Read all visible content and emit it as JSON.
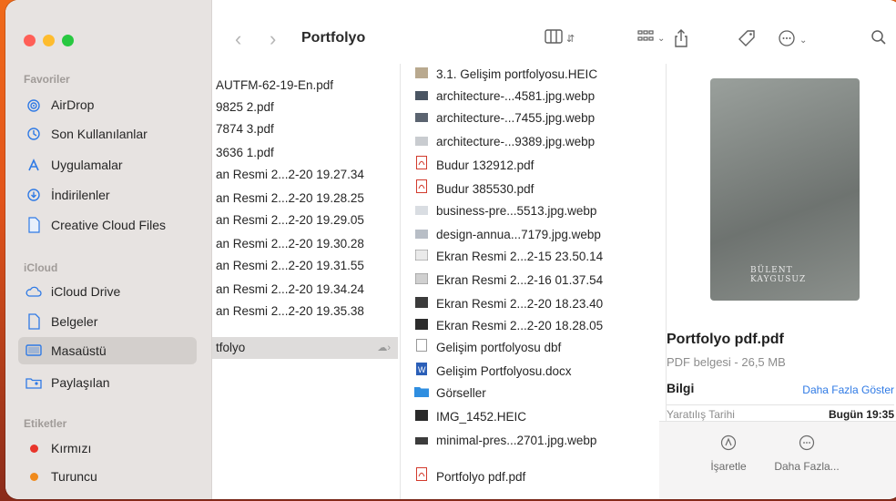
{
  "toolbar": {
    "title": "Portfolyo",
    "back_icon": "chevron-left-icon",
    "forward_icon": "chevron-right-icon"
  },
  "sidebar": {
    "favorites_header": "Favoriler",
    "favorites": [
      {
        "label": "AirDrop",
        "icon": "airdrop-icon"
      },
      {
        "label": "Son Kullanılanlar",
        "icon": "clock-icon"
      },
      {
        "label": "Uygulamalar",
        "icon": "apps-icon"
      },
      {
        "label": "İndirilenler",
        "icon": "download-icon"
      },
      {
        "label": "Creative Cloud Files",
        "icon": "document-icon"
      }
    ],
    "icloud_header": "iCloud",
    "icloud": [
      {
        "label": "iCloud Drive",
        "icon": "cloud-icon"
      },
      {
        "label": "Belgeler",
        "icon": "document-icon"
      },
      {
        "label": "Masaüstü",
        "icon": "desktop-icon"
      },
      {
        "label": "Paylaşılan",
        "icon": "shared-folder-icon"
      }
    ],
    "tags_header": "Etiketler",
    "tags": [
      {
        "label": "Kırmızı",
        "color": "#e8352b"
      },
      {
        "label": "Turuncu",
        "color": "#f08a1c"
      }
    ]
  },
  "column1": {
    "items": [
      "AUTFM-62-19-En.pdf",
      "9825 2.pdf",
      "7874 3.pdf",
      "3636 1.pdf",
      "an Resmi 2...2-20 19.27.34",
      "an Resmi 2...2-20 19.28.25",
      "an Resmi 2...2-20 19.29.05",
      "an Resmi 2...2-20 19.30.28",
      "an Resmi 2...2-20 19.31.55",
      "an Resmi 2...2-20 19.34.24",
      "an Resmi 2...2-20 19.35.38",
      "tfolyo"
    ]
  },
  "column2": {
    "items": [
      {
        "label": "3.1. Gelişim portfolyosu.HEIC",
        "icon": "image-icon"
      },
      {
        "label": "architecture-...4581.jpg.webp",
        "icon": "image-icon"
      },
      {
        "label": "architecture-...7455.jpg.webp",
        "icon": "image-icon"
      },
      {
        "label": "architecture-...9389.jpg.webp",
        "icon": "image-icon"
      },
      {
        "label": "Budur 132912.pdf",
        "icon": "pdf-icon"
      },
      {
        "label": "Budur 385530.pdf",
        "icon": "pdf-icon"
      },
      {
        "label": "business-pre...5513.jpg.webp",
        "icon": "image-icon"
      },
      {
        "label": "design-annua...7179.jpg.webp",
        "icon": "image-icon"
      },
      {
        "label": "Ekran Resmi 2...2-15 23.50.14",
        "icon": "image-icon"
      },
      {
        "label": "Ekran Resmi 2...2-16 01.37.54",
        "icon": "image-icon"
      },
      {
        "label": "Ekran Resmi 2...2-20 18.23.40",
        "icon": "image-icon"
      },
      {
        "label": "Ekran Resmi 2...2-20 18.28.05",
        "icon": "image-icon"
      },
      {
        "label": "Gelişim portfolyosu dbf",
        "icon": "file-icon"
      },
      {
        "label": "Gelişim Portfolyosu.docx",
        "icon": "word-icon"
      },
      {
        "label": "Görseller",
        "icon": "folder-icon"
      },
      {
        "label": "IMG_1452.HEIC",
        "icon": "image-icon"
      },
      {
        "label": "minimal-pres...2701.jpg.webp",
        "icon": "image-icon"
      },
      {
        "label": "Portfolyo pdf.pdf",
        "icon": "pdf-icon"
      }
    ]
  },
  "preview": {
    "thumb_text_1": "BÜLENT",
    "thumb_text_2": "KAYGUSUZ",
    "name": "Portfolyo pdf.pdf",
    "subtitle": "PDF belgesi - 26,5 MB",
    "info_label": "Bilgi",
    "more_link": "Daha Fazla Göster",
    "date_label": "Yaratılış Tarihi",
    "date_value": "Bugün 19:35",
    "action_mark": "İşaretle",
    "action_more": "Daha Fazla..."
  }
}
